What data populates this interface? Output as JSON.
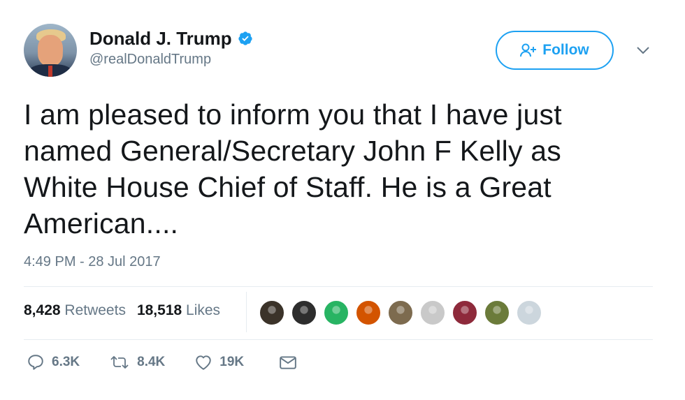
{
  "author": {
    "display_name": "Donald J. Trump",
    "handle": "@realDonaldTrump",
    "verified": true
  },
  "follow_button": {
    "label": "Follow"
  },
  "tweet": {
    "text": "I am pleased to inform you that I have just named General/Secretary John F Kelly as White House Chief of Staff. He is a Great American....",
    "timestamp": "4:49 PM - 28 Jul 2017"
  },
  "stats": {
    "retweets_count": "8,428",
    "retweets_label": "Retweets",
    "likes_count": "18,518",
    "likes_label": "Likes"
  },
  "liker_avatars": [
    "#3b3329",
    "#2d2d2d",
    "#28b463",
    "#d35400",
    "#7d6b4f",
    "#c9c9c9",
    "#8e2a3b",
    "#6b7b3a",
    "#ccd6dd"
  ],
  "actions": {
    "replies": "6.3K",
    "retweets": "8.4K",
    "likes": "19K"
  },
  "colors": {
    "accent": "#1da1f2",
    "secondary_text": "#657786",
    "divider": "#e6ecf0"
  }
}
